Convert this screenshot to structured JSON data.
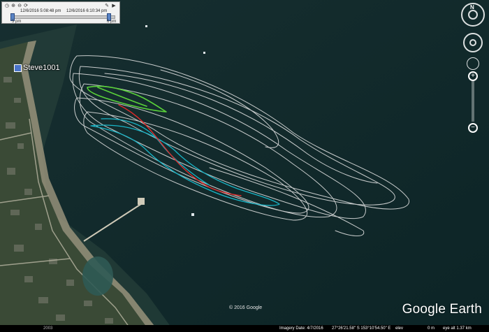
{
  "timeslider": {
    "start_time": "12/6/2016 5:08:48 pm",
    "end_time": "12/6/2016 6:10:34 pm",
    "start_label": "5 pm",
    "end_label": "6 pm"
  },
  "placemark": {
    "label": "Steve1001"
  },
  "navigation": {
    "north": "N"
  },
  "map": {
    "copyright": "© 2016 Google",
    "logo": "Google Earth"
  },
  "statusbar": {
    "imagery_date": "Imagery Date: 4/7/2016",
    "coordinates": "27°26'21.58\" S  153°10'54.50\" E",
    "elev_label": "elev",
    "elev_value": "0 m",
    "eye_alt": "eye alt  1.37 km",
    "year": "2003"
  },
  "colors": {
    "water": "#0f2a2c",
    "land": "#3a4a36",
    "track_white": "#e8e8e8",
    "track_cyan": "#19b6c8",
    "track_red": "#e22a2a",
    "track_green": "#5ad23a"
  }
}
